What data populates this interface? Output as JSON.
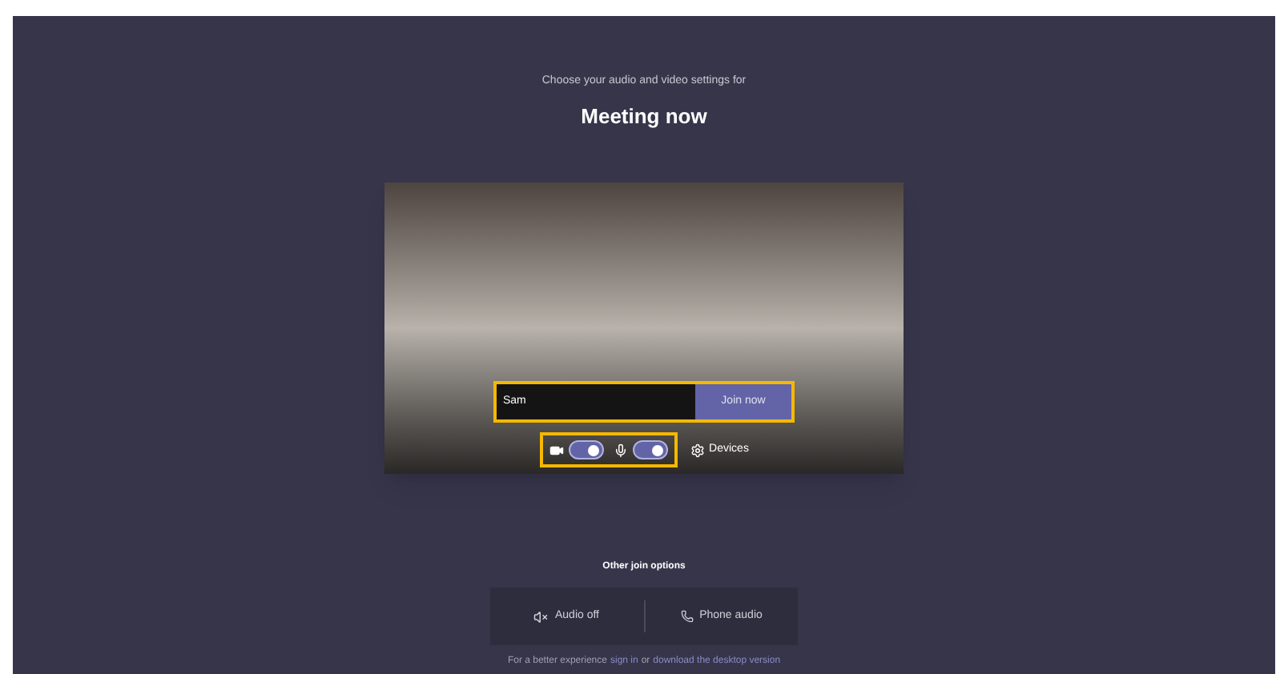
{
  "header": {
    "subtitle": "Choose your audio and video settings for",
    "title": "Meeting now"
  },
  "join": {
    "name_value": "Sam",
    "join_button": "Join now"
  },
  "toggles": [
    {
      "kind": "camera",
      "on": true
    },
    {
      "kind": "microphone",
      "on": true
    }
  ],
  "devices_button": "Devices",
  "other_options": {
    "heading": "Other join options",
    "buttons": [
      {
        "kind": "audio-off",
        "label": "Audio off"
      },
      {
        "kind": "phone",
        "label": "Phone audio"
      }
    ]
  },
  "footer": [
    {
      "kind": "text",
      "text": "For a better experience"
    },
    {
      "kind": "link",
      "text": "sign in"
    },
    {
      "kind": "text",
      "text": "or"
    },
    {
      "kind": "link",
      "text": "download the desktop version"
    }
  ]
}
